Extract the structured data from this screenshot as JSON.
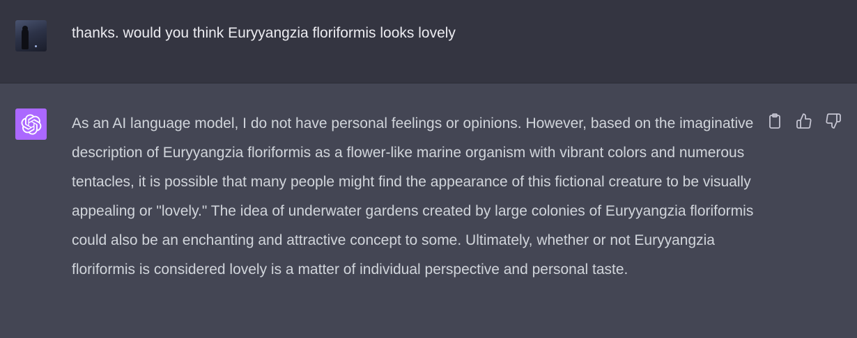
{
  "user_message": {
    "text": "thanks. would you think Euryyangzia floriformis looks lovely"
  },
  "assistant_message": {
    "text": "As an AI language model, I do not have personal feelings or opinions. However, based on the imaginative description of Euryyangzia floriformis as a flower-like marine organism with vibrant colors and numerous tentacles, it is possible that many people might find the appearance of this fictional creature to be visually appealing or \"lovely.\" The idea of underwater gardens created by large colonies of Euryyangzia floriformis could also be an enchanting and attractive concept to some. Ultimately, whether or not Euryyangzia floriformis is considered lovely is a matter of individual perspective and personal taste.",
    "actions": [
      "copy-icon",
      "thumbs-up-icon",
      "thumbs-down-icon"
    ]
  },
  "colors": {
    "user_bg": "#343541",
    "assistant_bg": "#444654",
    "assistant_avatar": "#ab68ff",
    "user_text": "#ececf1",
    "assistant_text": "#d1d5db",
    "icon": "#c5c5d2"
  }
}
